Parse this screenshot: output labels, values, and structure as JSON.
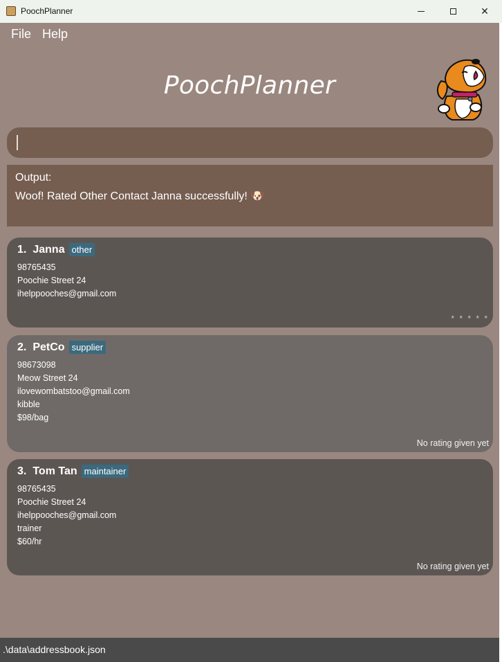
{
  "window": {
    "title": "PoochPlanner",
    "minimize": "minimize",
    "maximize": "maximize",
    "close": "close"
  },
  "menu": {
    "items": [
      {
        "label": "File"
      },
      {
        "label": "Help"
      }
    ]
  },
  "header": {
    "title": "PoochPlanner",
    "mascot_icon": "dog-mascot-icon"
  },
  "command": {
    "value": ""
  },
  "output": {
    "label": "Output:",
    "message": "Woof! Rated Other Contact Janna successfully! 🐶"
  },
  "contacts": [
    {
      "index": "1.",
      "name": "Janna",
      "tag": "other",
      "fields": [
        "98765435",
        "Poochie Street 24",
        "ihelppooches@gmail.com"
      ],
      "rating": "* * * * *"
    },
    {
      "index": "2.",
      "name": "PetCo",
      "tag": "supplier",
      "fields": [
        "98673098",
        "Meow Street 24",
        "ilovewombatstoo@gmail.com",
        "kibble",
        "$98/bag"
      ],
      "rating": "No rating given yet"
    },
    {
      "index": "3.",
      "name": "Tom Tan",
      "tag": "maintainer",
      "fields": [
        "98765435",
        "Poochie Street 24",
        "ihelppooches@gmail.com",
        "trainer",
        "$60/hr"
      ],
      "rating": "No rating given yet"
    }
  ],
  "status": {
    "path": ".\\data\\addressbook.json"
  },
  "colors": {
    "background": "#9a8780",
    "panel": "#755d50",
    "card_dark": "#5c5653",
    "card_light": "#6f6a67",
    "tag": "#3b6a7e",
    "status_bar": "#4a4a4a"
  }
}
